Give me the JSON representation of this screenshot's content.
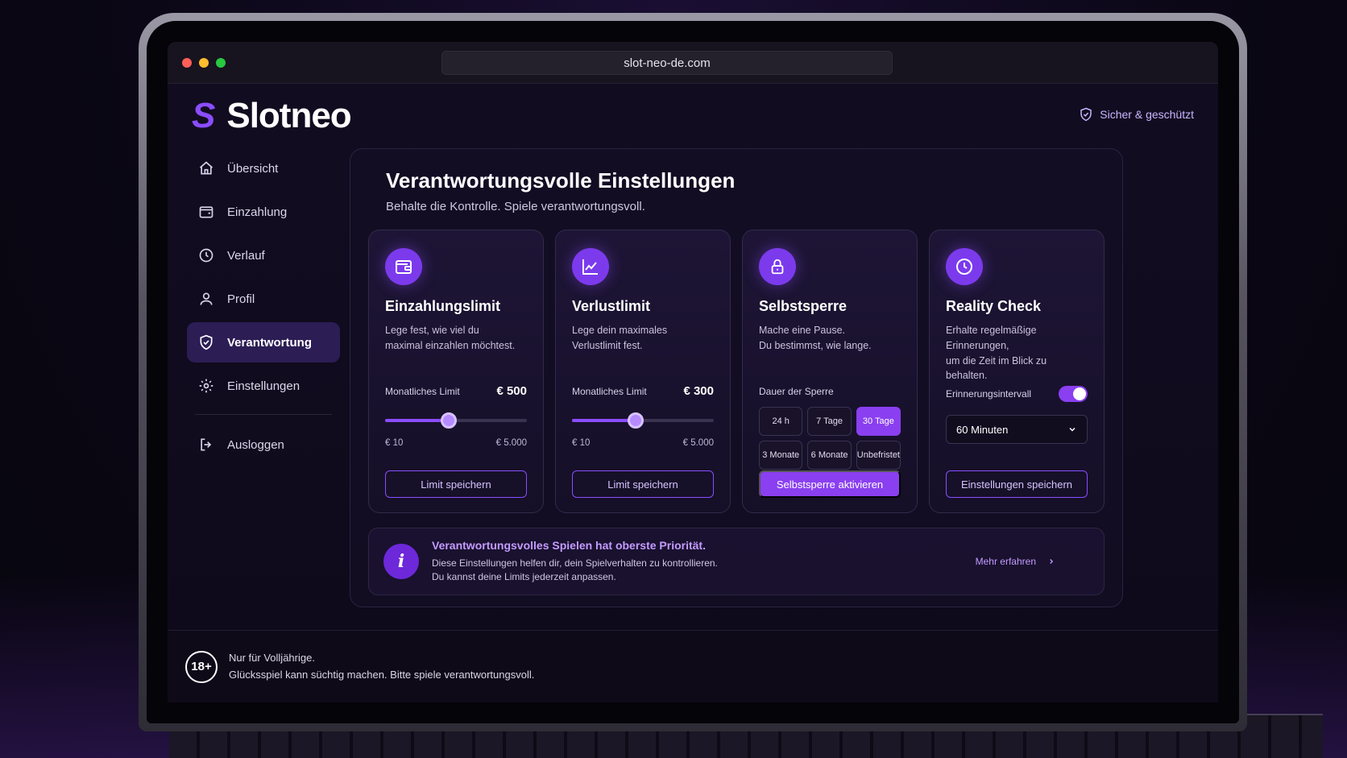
{
  "browser": {
    "url": "slot-neo-de.com"
  },
  "brand": {
    "logo_mark": "S",
    "name": "Slotneo",
    "accent": "#8a4dff"
  },
  "header": {
    "safe_label": "Sicher & geschützt"
  },
  "sidebar": {
    "items": [
      {
        "label": "Übersicht",
        "icon": "home-icon"
      },
      {
        "label": "Einzahlung",
        "icon": "wallet-icon"
      },
      {
        "label": "Verlauf",
        "icon": "clock-icon"
      },
      {
        "label": "Profil",
        "icon": "user-icon"
      },
      {
        "label": "Verantwortung",
        "icon": "shield-icon",
        "active": true
      },
      {
        "label": "Einstellungen",
        "icon": "gear-icon"
      }
    ],
    "logout": {
      "label": "Ausloggen",
      "icon": "logout-icon"
    }
  },
  "main": {
    "title": "Verantwortungsvolle Einstellungen",
    "subtitle": "Behalte die Kontrolle. Spiele verantwortungsvoll."
  },
  "cards": {
    "deposit": {
      "title": "Einzahlungslimit",
      "desc_line1": "Lege fest, wie viel du",
      "desc_line2": "maximal einzahlen möchtest.",
      "limit_label": "Monatliches Limit",
      "value_label": "€ 500",
      "slider_fraction": 0.45,
      "min_label": "€ 10",
      "max_label": "€ 5.000",
      "button": "Limit speichern",
      "icon": "wallet-icon"
    },
    "loss": {
      "title": "Verlustlimit",
      "desc_line1": "Lege dein maximales",
      "desc_line2": "Verlustlimit fest.",
      "limit_label": "Monatliches Limit",
      "value_label": "€ 300",
      "slider_fraction": 0.45,
      "min_label": "€ 10",
      "max_label": "€ 5.000",
      "button": "Limit speichern",
      "icon": "chart-line-icon"
    },
    "selfban": {
      "title": "Selbstsperre",
      "desc_line1": "Mache eine Pause.",
      "desc_line2": "Du bestimmst, wie lange.",
      "duration_label": "Dauer der Sperre",
      "durations": [
        "24 h",
        "7 Tage",
        "30 Tage",
        "3 Monate",
        "6 Monate",
        "Unbefristet"
      ],
      "selected_duration": "30 Tage",
      "button": "Selbstsperre aktivieren",
      "icon": "lock-icon"
    },
    "reality": {
      "title": "Reality Check",
      "desc_line1": "Erhalte regelmäßige Erinnerungen,",
      "desc_line2": "um die Zeit im Blick zu behalten.",
      "interval_label": "Erinnerungsintervall",
      "toggle_on": true,
      "select_value": "60 Minuten",
      "button": "Einstellungen speichern",
      "icon": "clock-icon"
    }
  },
  "info": {
    "icon_glyph": "i",
    "title": "Verantwortungsvolles Spielen hat oberste Priorität.",
    "line1": "Diese Einstellungen helfen dir, dein Spielverhalten zu kontrollieren.",
    "line2": "Du kannst deine Limits jederzeit anpassen.",
    "link": "Mehr erfahren"
  },
  "footer": {
    "age_badge": "18+",
    "line1": "Nur für Volljährige.",
    "line2": "Glücksspiel kann süchtig machen. Bitte spiele verantwortungsvoll."
  }
}
